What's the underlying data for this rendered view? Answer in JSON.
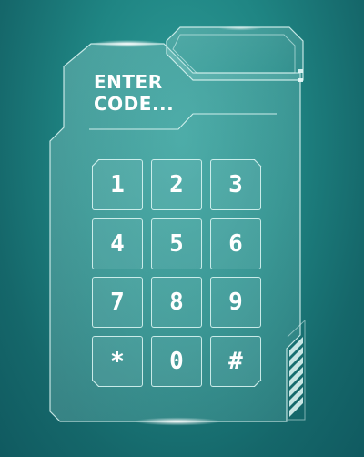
{
  "title": {
    "line1": "ENTER",
    "line2": "CODE..."
  },
  "keypad": {
    "keys": [
      {
        "label": "1"
      },
      {
        "label": "2"
      },
      {
        "label": "3"
      },
      {
        "label": "4"
      },
      {
        "label": "5"
      },
      {
        "label": "6"
      },
      {
        "label": "7"
      },
      {
        "label": "8"
      },
      {
        "label": "9"
      },
      {
        "label": "*"
      },
      {
        "label": "0"
      },
      {
        "label": "#"
      }
    ]
  },
  "colors": {
    "background": "#1f8583",
    "panel_fill": "#8fd0cc",
    "panel_stroke": "#dff7f5",
    "text": "#ffffff"
  }
}
